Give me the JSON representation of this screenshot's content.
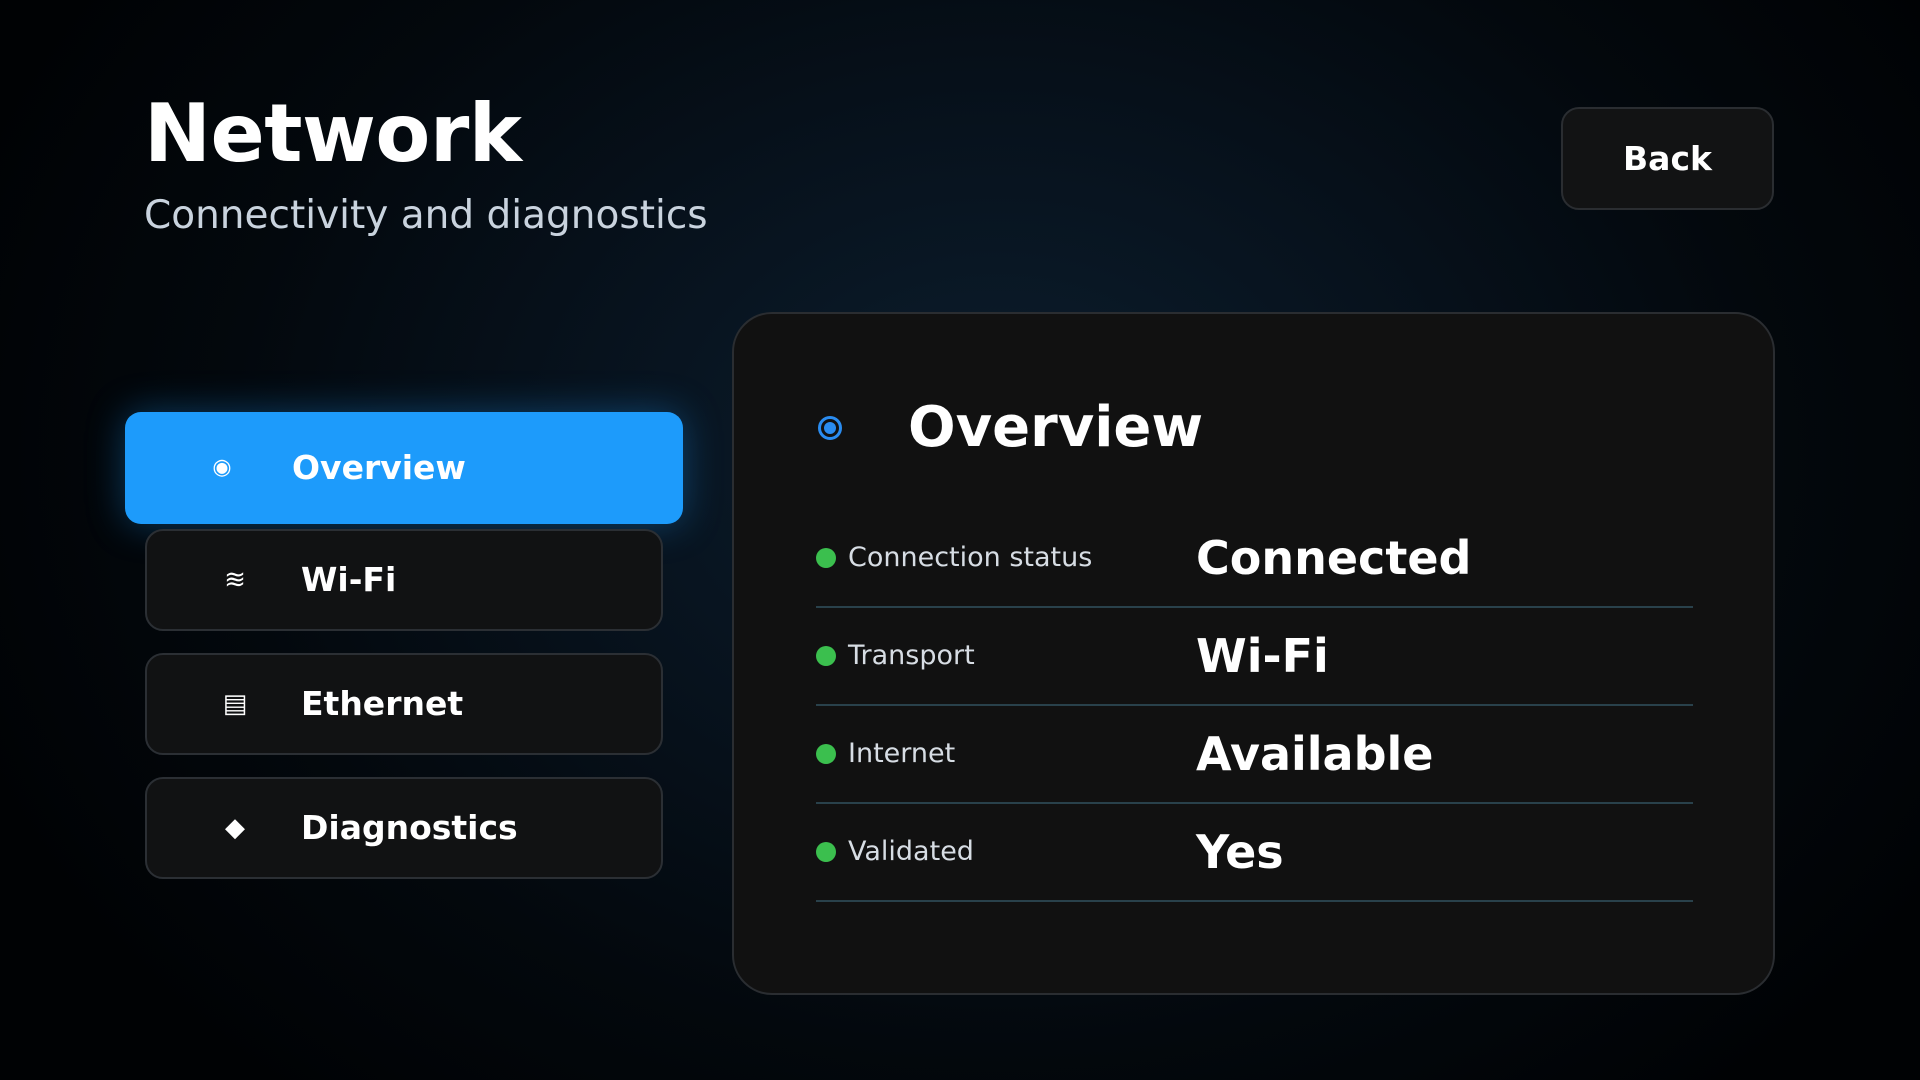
{
  "header": {
    "title": "Network",
    "subtitle": "Connectivity and diagnostics",
    "back_label": "Back"
  },
  "sidebar": {
    "items": [
      {
        "label": "Overview",
        "icon": "◉",
        "icon_name": "radio-dot-icon",
        "active": true
      },
      {
        "label": "Wi-Fi",
        "icon": "≋",
        "icon_name": "wifi-waves-icon",
        "active": false
      },
      {
        "label": "Ethernet",
        "icon": "▤",
        "icon_name": "ethernet-lines-icon",
        "active": false
      },
      {
        "label": "Diagnostics",
        "icon": "◆",
        "icon_name": "diamond-icon",
        "active": false
      }
    ]
  },
  "panel": {
    "title": "Overview",
    "icon_name": "radio-dot-icon",
    "rows": [
      {
        "label": "Connection status",
        "value": "Connected"
      },
      {
        "label": "Transport",
        "value": "Wi-Fi"
      },
      {
        "label": "Internet",
        "value": "Available"
      },
      {
        "label": "Validated",
        "value": "Yes"
      }
    ]
  },
  "colors": {
    "accent": "#1d9bfb",
    "status_ok": "#3bbf4e",
    "panel_bg": "#111111"
  }
}
